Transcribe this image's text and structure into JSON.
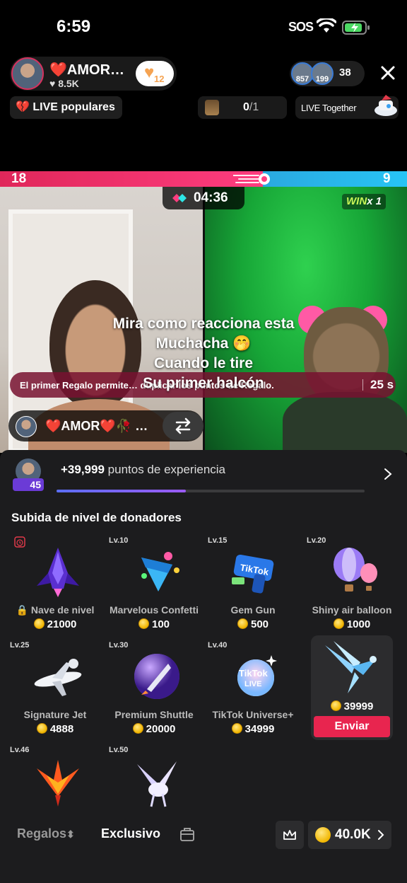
{
  "status_bar": {
    "time": "6:59",
    "sos": "SOS"
  },
  "host": {
    "name": "❤️AMOR…",
    "likes": "8.5K",
    "follow_count": "12"
  },
  "viewers": {
    "avatar1_badge": "857",
    "avatar2_badge": "199",
    "count": "38"
  },
  "popular": {
    "icon": "💔",
    "label": "LIVE populares"
  },
  "goal": {
    "current": "0",
    "total": "/1"
  },
  "together": {
    "label": "LIVE Together"
  },
  "battle": {
    "left_score": "18",
    "right_score": "9",
    "left_share": 0.646,
    "timer": "04:36",
    "win_label": "WIN",
    "win_count": "x 1"
  },
  "caption": {
    "line1": "Mira como reacciona esta",
    "line2": "Muchacha 🤭",
    "line3": "Cuando le tire",
    "line4": "Su primer halcón"
  },
  "notice": {
    "text": "El primer Regalo permite… duplicar los puntos de Regalo.",
    "seconds": "25 s"
  },
  "opponent": {
    "name": "❤️AMOR❤️🥀 …"
  },
  "xp": {
    "level": "45",
    "points": "+39,999",
    "text": "puntos de experiencia",
    "progress": 0.42
  },
  "section_title": "Subida de nivel de donadores",
  "gifts": [
    {
      "level": "",
      "name": "Nave de nivel",
      "price": "21000",
      "icon": "rocket-ship-icon"
    },
    {
      "level": "Lv.10",
      "name": "Marvelous Confetti",
      "price": "100",
      "icon": "confetti-icon"
    },
    {
      "level": "Lv.15",
      "name": "Gem Gun",
      "price": "500",
      "icon": "gem-gun-icon"
    },
    {
      "level": "Lv.20",
      "name": "Shiny air balloon",
      "price": "1000",
      "icon": "air-balloon-icon"
    },
    {
      "level": "Lv.25",
      "name": "Signature Jet",
      "price": "4888",
      "icon": "jet-icon"
    },
    {
      "level": "Lv.30",
      "name": "Premium Shuttle",
      "price": "20000",
      "icon": "shuttle-icon"
    },
    {
      "level": "Lv.40",
      "name": "TikTok Universe+",
      "price": "34999",
      "icon": "universe-icon"
    },
    {
      "level": "",
      "name": "",
      "price": "39999",
      "icon": "falcon-icon",
      "send": "Enviar"
    },
    {
      "level": "Lv.46",
      "name": "",
      "price": "",
      "icon": "phoenix-icon"
    },
    {
      "level": "Lv.50",
      "name": "",
      "price": "",
      "icon": "pegasus-icon"
    }
  ],
  "bottom": {
    "tab1": "Regalos",
    "tab1_suffix": "⬍",
    "tab2": "Exclusivo",
    "balance": "40.0K"
  }
}
